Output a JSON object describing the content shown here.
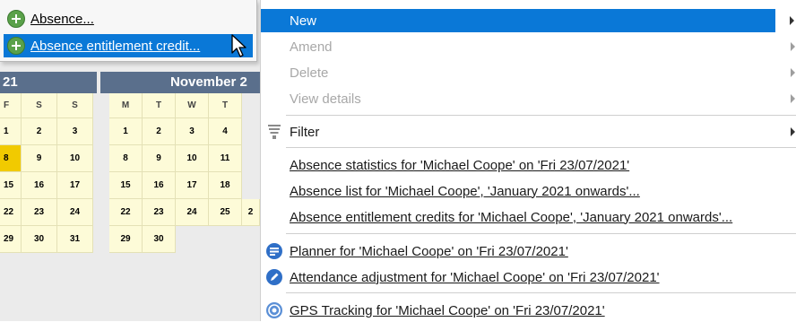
{
  "popup": {
    "items": [
      {
        "label": "Absence...",
        "selected": false
      },
      {
        "label": "Absence entitlement credit...",
        "selected": true
      }
    ]
  },
  "calendar": {
    "left_header": "21",
    "right_header": "November 2",
    "left": {
      "days": [
        "F",
        "S",
        "S"
      ],
      "rows": [
        [
          "1",
          "2",
          "3"
        ],
        [
          "8",
          "9",
          "10"
        ],
        [
          "15",
          "16",
          "17"
        ],
        [
          "22",
          "23",
          "24"
        ],
        [
          "29",
          "30",
          "31"
        ]
      ],
      "today": "8"
    },
    "right": {
      "days": [
        "M",
        "T",
        "W",
        "T",
        ""
      ],
      "rows": [
        [
          "1",
          "2",
          "3",
          "4",
          ""
        ],
        [
          "8",
          "9",
          "10",
          "11",
          ""
        ],
        [
          "15",
          "16",
          "17",
          "18",
          ""
        ],
        [
          "22",
          "23",
          "24",
          "25",
          "2"
        ],
        [
          "29",
          "30",
          "",
          "",
          ""
        ]
      ]
    }
  },
  "menu": {
    "new": "New",
    "amend": "Amend",
    "delete": "Delete",
    "view_details": "View details",
    "filter": "Filter",
    "absence_stats": "Absence statistics for 'Michael Coope' on 'Fri 23/07/2021'",
    "absence_list": "Absence list for 'Michael Coope', 'January 2021 onwards'...",
    "absence_entitlement": "Absence entitlement credits for 'Michael Coope', 'January 2021 onwards'...",
    "planner": "Planner for 'Michael Coope' on 'Fri 23/07/2021'",
    "attendance": "Attendance adjustment for 'Michael Coope' on 'Fri 23/07/2021'",
    "gps": "GPS Tracking for 'Michael Coope' on 'Fri 23/07/2021'"
  },
  "colors": {
    "highlight": "#0a78d7",
    "calendar_header": "#5a6f8c",
    "calendar_bg": "#fdfbd8",
    "today": "#f1ca00"
  }
}
